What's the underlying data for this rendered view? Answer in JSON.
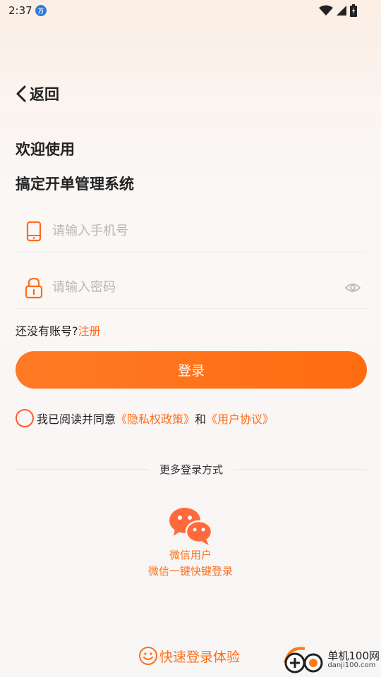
{
  "status": {
    "time": "2:37",
    "app_badge": "万"
  },
  "header": {
    "back_label": "返回"
  },
  "welcome": {
    "line1": "欢迎使用",
    "line2": "搞定开单管理系统"
  },
  "form": {
    "phone_placeholder": "请输入手机号",
    "password_placeholder": "请输入密码",
    "no_account_text": "还没有账号?",
    "register_label": "注册",
    "login_label": "登录"
  },
  "agreement": {
    "prefix": "我已阅读并同意",
    "privacy_label": "《隐私权政策》",
    "and_text": "和",
    "user_agreement_label": "《用户协议》"
  },
  "more_login": {
    "title": "更多登录方式",
    "wechat_user": "微信用户",
    "wechat_subtitle": "微信一键快键登录"
  },
  "quick_login": {
    "label": "快速登录体验"
  },
  "watermark": {
    "cn": "单机100网",
    "en": "danji100.com"
  },
  "colors": {
    "accent": "#ff6d1a",
    "text": "#222222",
    "placeholder": "#b8b8b8"
  }
}
